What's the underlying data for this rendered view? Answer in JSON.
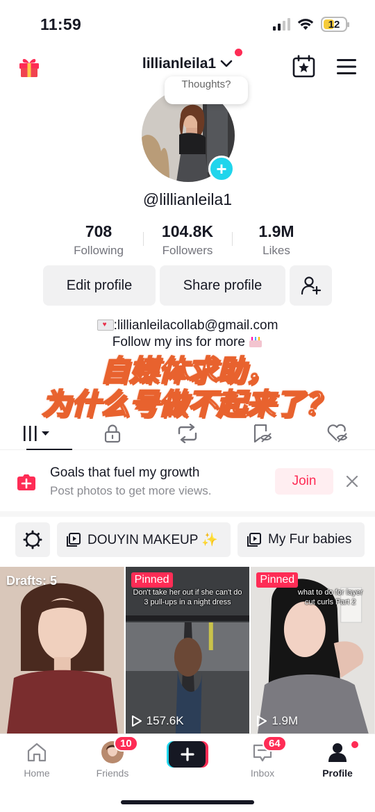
{
  "status_bar": {
    "time": "11:59",
    "battery": "12"
  },
  "header": {
    "username": "lillianleila1"
  },
  "profile": {
    "note_bubble": "Thoughts?",
    "handle": "@lillianleila1",
    "stats": [
      {
        "value": "708",
        "label": "Following"
      },
      {
        "value": "104.8K",
        "label": "Followers"
      },
      {
        "value": "1.9M",
        "label": "Likes"
      }
    ],
    "edit_label": "Edit profile",
    "share_label": "Share profile",
    "bio_email": ":lillianleilacollab@gmail.com",
    "bio_follow": "Follow my ins for more"
  },
  "overlay_text": {
    "line1": "自媒体求助，",
    "line2": "为什么号做不起来了？"
  },
  "goal_card": {
    "title": "Goals that fuel my growth",
    "subtitle": "Post photos to get more views.",
    "join_label": "Join"
  },
  "collections": [
    {
      "label": "DOUYIN MAKEUP ✨"
    },
    {
      "label": "My Fur babies"
    }
  ],
  "videos": [
    {
      "drafts": "Drafts: 5"
    },
    {
      "pinned": "Pinned",
      "caption": "Don't take her out if she can't do 3 pull-ups in a night dress",
      "views": "157.6K"
    },
    {
      "pinned": "Pinned",
      "caption": "what to do for layer cut curls Part 2",
      "views": "1.9M"
    }
  ],
  "nav": {
    "home": "Home",
    "friends": "Friends",
    "friends_badge": "10",
    "inbox": "Inbox",
    "inbox_badge": "64",
    "profile": "Profile"
  },
  "colors": {
    "accent": "#fe2c55",
    "teal": "#20d5ec",
    "overlay_stroke": "#e8622e"
  }
}
